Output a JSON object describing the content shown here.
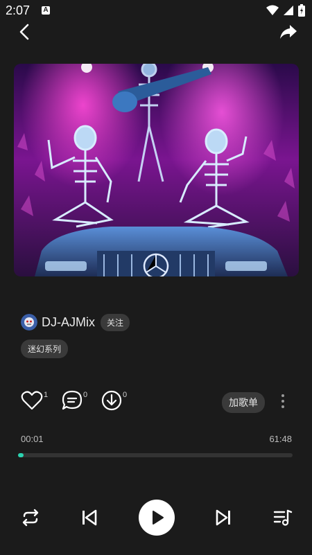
{
  "status_bar": {
    "time": "2:07",
    "a_badge": "A"
  },
  "artist": {
    "name": "DJ-AJMix",
    "follow_label": "关注"
  },
  "tag": "迷幻系列",
  "actions": {
    "like_count": "1",
    "comment_count": "0",
    "download_count": "0",
    "add_to_playlist_label": "加歌单"
  },
  "player": {
    "current_time": "00:01",
    "total_time": "61:48",
    "progress_fraction": 0.02
  },
  "colors": {
    "accent": "#2bd3b0",
    "background": "#1b1b1b",
    "chip": "#3a3a3a"
  },
  "icons": {
    "back": "back-arrow-icon",
    "share": "share-icon",
    "like": "heart-icon",
    "comment": "comment-icon",
    "download": "download-icon",
    "more": "more-vertical-icon",
    "repeat": "repeat-icon",
    "prev": "skip-previous-icon",
    "play": "play-icon",
    "next": "skip-next-icon",
    "queue": "playlist-icon"
  }
}
